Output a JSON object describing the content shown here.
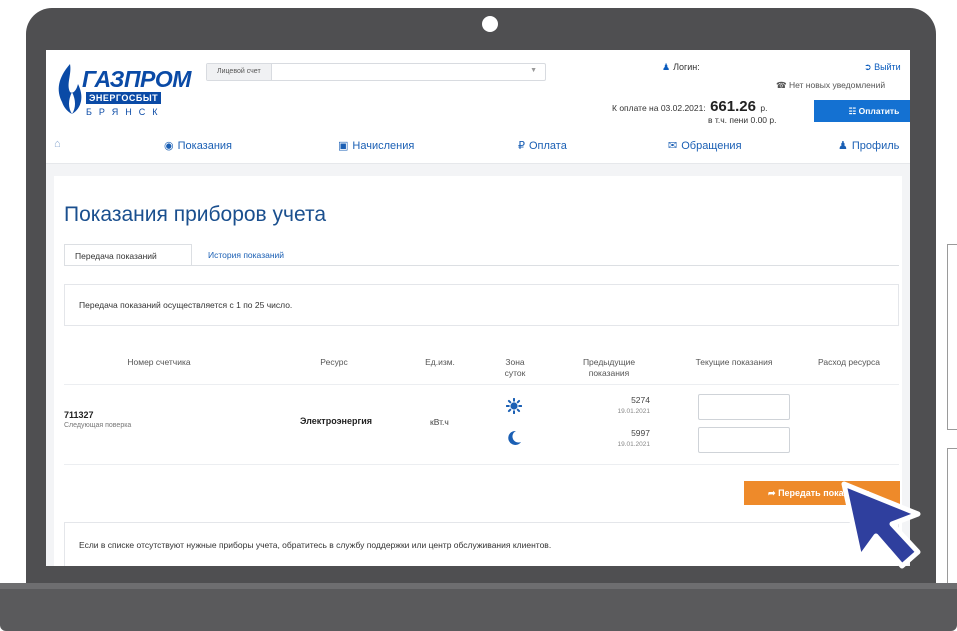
{
  "header": {
    "logo": {
      "brand": "ГАЗПРОМ",
      "sub": "ЭНЕРГОСБЫТ",
      "city": "БРЯНСК"
    },
    "account_label": "Лицевой счет",
    "login_label": "Логин:",
    "logout_label": "Выйти",
    "notifications": "Нет новых уведомлений",
    "pay_prefix": "К оплате на 03.02.2021:",
    "pay_amount": "661.26",
    "pay_currency": "р.",
    "penalty": "в т.ч. пени 0.00 р.",
    "pay_button": "Оплатить"
  },
  "nav": {
    "items": [
      {
        "label": "Показания",
        "icon": "gauge-icon"
      },
      {
        "label": "Начисления",
        "icon": "wallet-icon"
      },
      {
        "label": "Оплата",
        "icon": "ruble-icon"
      },
      {
        "label": "Обращения",
        "icon": "chat-icon"
      },
      {
        "label": "Профиль",
        "icon": "users-icon"
      }
    ]
  },
  "main": {
    "title": "Показания приборов учета",
    "tabs": [
      {
        "label": "Передача показаний",
        "active": true
      },
      {
        "label": "История показаний",
        "active": false
      }
    ],
    "info": "Передача показаний осуществляется с 1 по 25 число.",
    "table": {
      "headers": {
        "meter": "Номер счетчика",
        "resource": "Ресурс",
        "unit": "Ед.изм.",
        "zone_1": "Зона",
        "zone_2": "суток",
        "prev_1": "Предыдущие",
        "prev_2": "показания",
        "current": "Текущие показания",
        "usage": "Расход ресурса"
      },
      "row": {
        "meter_number": "711327",
        "next_check": "Следующая поверка",
        "resource": "Электроэнергия",
        "unit": "кВт.ч",
        "day_prev": "5274",
        "day_date": "19.01.2021",
        "night_prev": "5997",
        "night_date": "19.01.2021",
        "day_value": "",
        "night_value": ""
      }
    },
    "submit_button": "Передать показания",
    "footer_note": "Если в списке отсутствуют нужные приборы учета, обратитесь в службу поддержки или центр обслуживания клиентов."
  },
  "colors": {
    "brand_blue": "#0a4aa6",
    "link_blue": "#1a5fb4",
    "pay_button": "#1471d2",
    "submit_orange": "#ee8a2a",
    "annotation_red": "#d8141c",
    "cursor_blue": "#2f3f9e"
  }
}
